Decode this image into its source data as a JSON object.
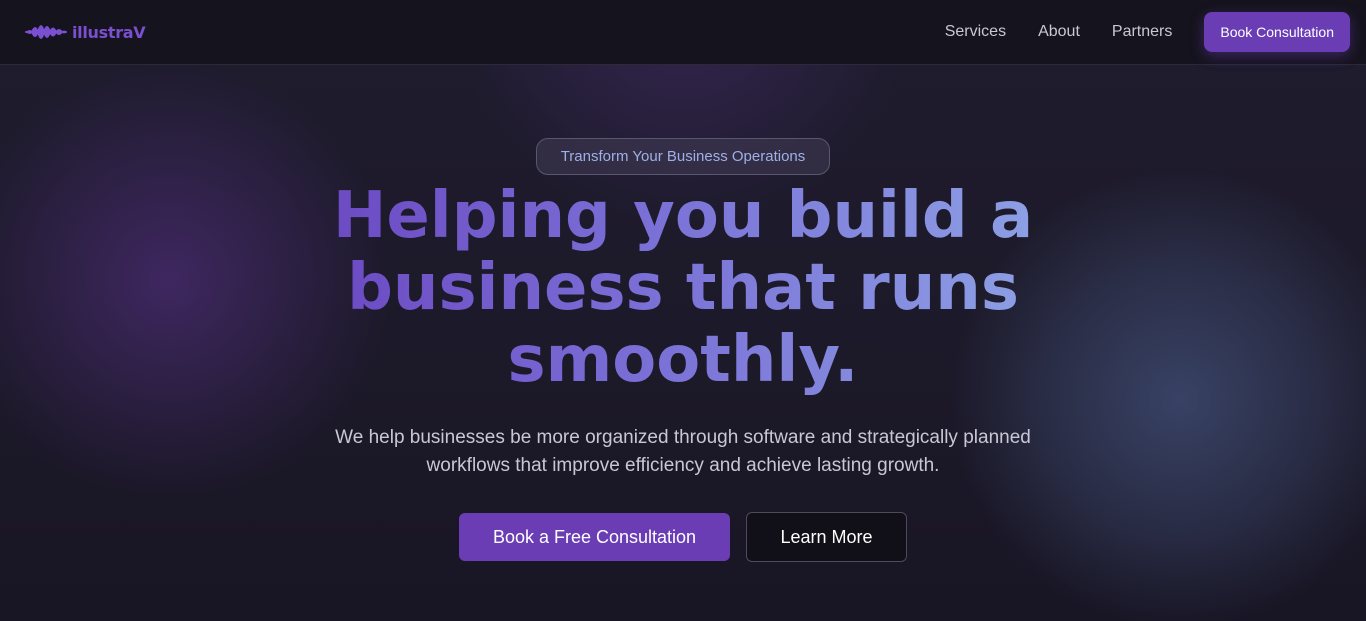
{
  "header": {
    "logo_text": "illustraV",
    "logo_icon": "waveform-logo-icon",
    "nav": [
      {
        "label": "Services"
      },
      {
        "label": "About"
      },
      {
        "label": "Partners"
      }
    ],
    "cta_label": "Book Consultation"
  },
  "hero": {
    "badge": "Transform Your Business Operations",
    "headline_lines": [
      "Helping you build a",
      "business that runs",
      "smoothly."
    ],
    "subtext_lines": [
      "We help businesses be more organized through software and strategically planned",
      "workflows that improve efficiency and achieve lasting growth."
    ],
    "primary_button": "Book a Free Consultation",
    "secondary_button": "Learn More"
  },
  "colors": {
    "accent": "#6a3db5",
    "background": "#1a1726",
    "header_background": "#15131d",
    "badge_text": "#9fb0e6",
    "headline_gradient_start": "#6a45c0",
    "headline_gradient_end": "#8fa5e6"
  }
}
